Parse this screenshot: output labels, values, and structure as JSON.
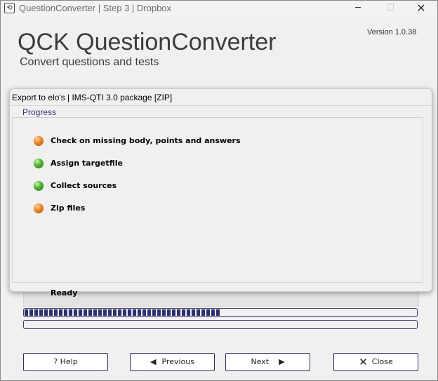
{
  "window": {
    "title": "QuestionConverter | Step 3 | Dropbox",
    "icon": "app-icon",
    "controls": {
      "minimize": "─",
      "maximize": "☐",
      "close": "✕"
    }
  },
  "header": {
    "app_name": "QCK QuestionConverter",
    "subtitle": "Convert questions and tests",
    "version": "Version 1.0.38"
  },
  "dialog": {
    "title": "Export to elo's | IMS-QTI 3.0 package [ZIP]",
    "group_label": "Progress",
    "steps": [
      {
        "label": "Check on missing body, points and answers",
        "status": "orange"
      },
      {
        "label": "Assign targetfile",
        "status": "green"
      },
      {
        "label": "Collect sources",
        "status": "green"
      },
      {
        "label": "Zip files",
        "status": "orange"
      }
    ],
    "status_text": "Ready"
  },
  "progress": {
    "bar1_fraction": 0.5,
    "bar2_fraction": 0.0
  },
  "buttons": {
    "help": {
      "label": "? Help"
    },
    "previous": {
      "label": "Previous",
      "icon": "arrow-left-icon"
    },
    "next": {
      "label": "Next",
      "icon": "arrow-right-icon"
    },
    "close": {
      "label": "Close",
      "icon": "close-x-icon"
    }
  },
  "colors": {
    "accent": "#2e2e78",
    "status_orange": "#f0821e",
    "status_green": "#4cb32a"
  }
}
